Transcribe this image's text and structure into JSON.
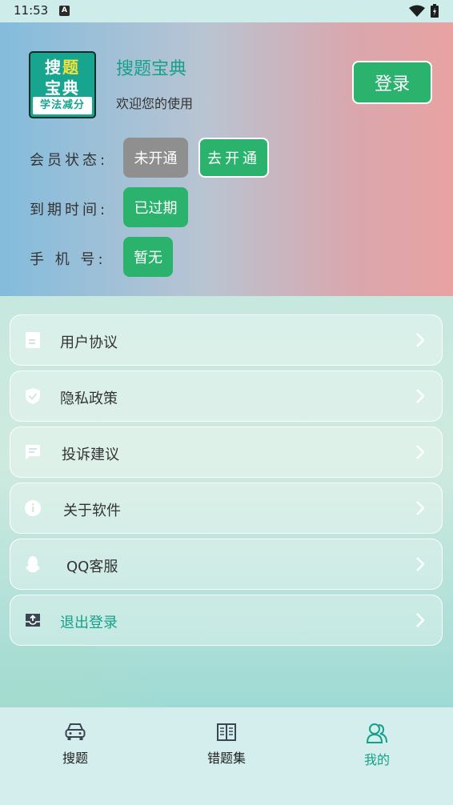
{
  "status_bar": {
    "time": "11:53",
    "notification_icon": "A"
  },
  "header": {
    "logo": {
      "row1_a": "搜",
      "row1_b": "题",
      "row2": "宝典",
      "strip": "学法减分"
    },
    "app_title": "搜题宝典",
    "welcome": "欢迎您的使用",
    "login_label": "登录",
    "membership_label": "会员状态:",
    "membership_value": "未开通",
    "open_button": "去开通",
    "expiry_label": "到期时间:",
    "expiry_value": "已过期",
    "phone_label": "手 机 号:",
    "phone_value": "暂无"
  },
  "menu": [
    {
      "label": "用户协议",
      "icon": "document-icon"
    },
    {
      "label": "隐私政策",
      "icon": "shield-check-icon"
    },
    {
      "label": "投诉建议",
      "icon": "chat-icon"
    },
    {
      "label": "关于软件",
      "icon": "info-icon"
    },
    {
      "label": "QQ客服",
      "icon": "qq-icon"
    },
    {
      "label": "退出登录",
      "icon": "logout-tray-icon"
    }
  ],
  "tabs": [
    {
      "label": "搜题",
      "icon": "car-icon"
    },
    {
      "label": "错题集",
      "icon": "book-icon"
    },
    {
      "label": "我的",
      "icon": "user-icon"
    }
  ],
  "colors": {
    "accent": "#16a08a",
    "button_green": "#2bb36e",
    "pill_gray": "#8f8f8f"
  }
}
